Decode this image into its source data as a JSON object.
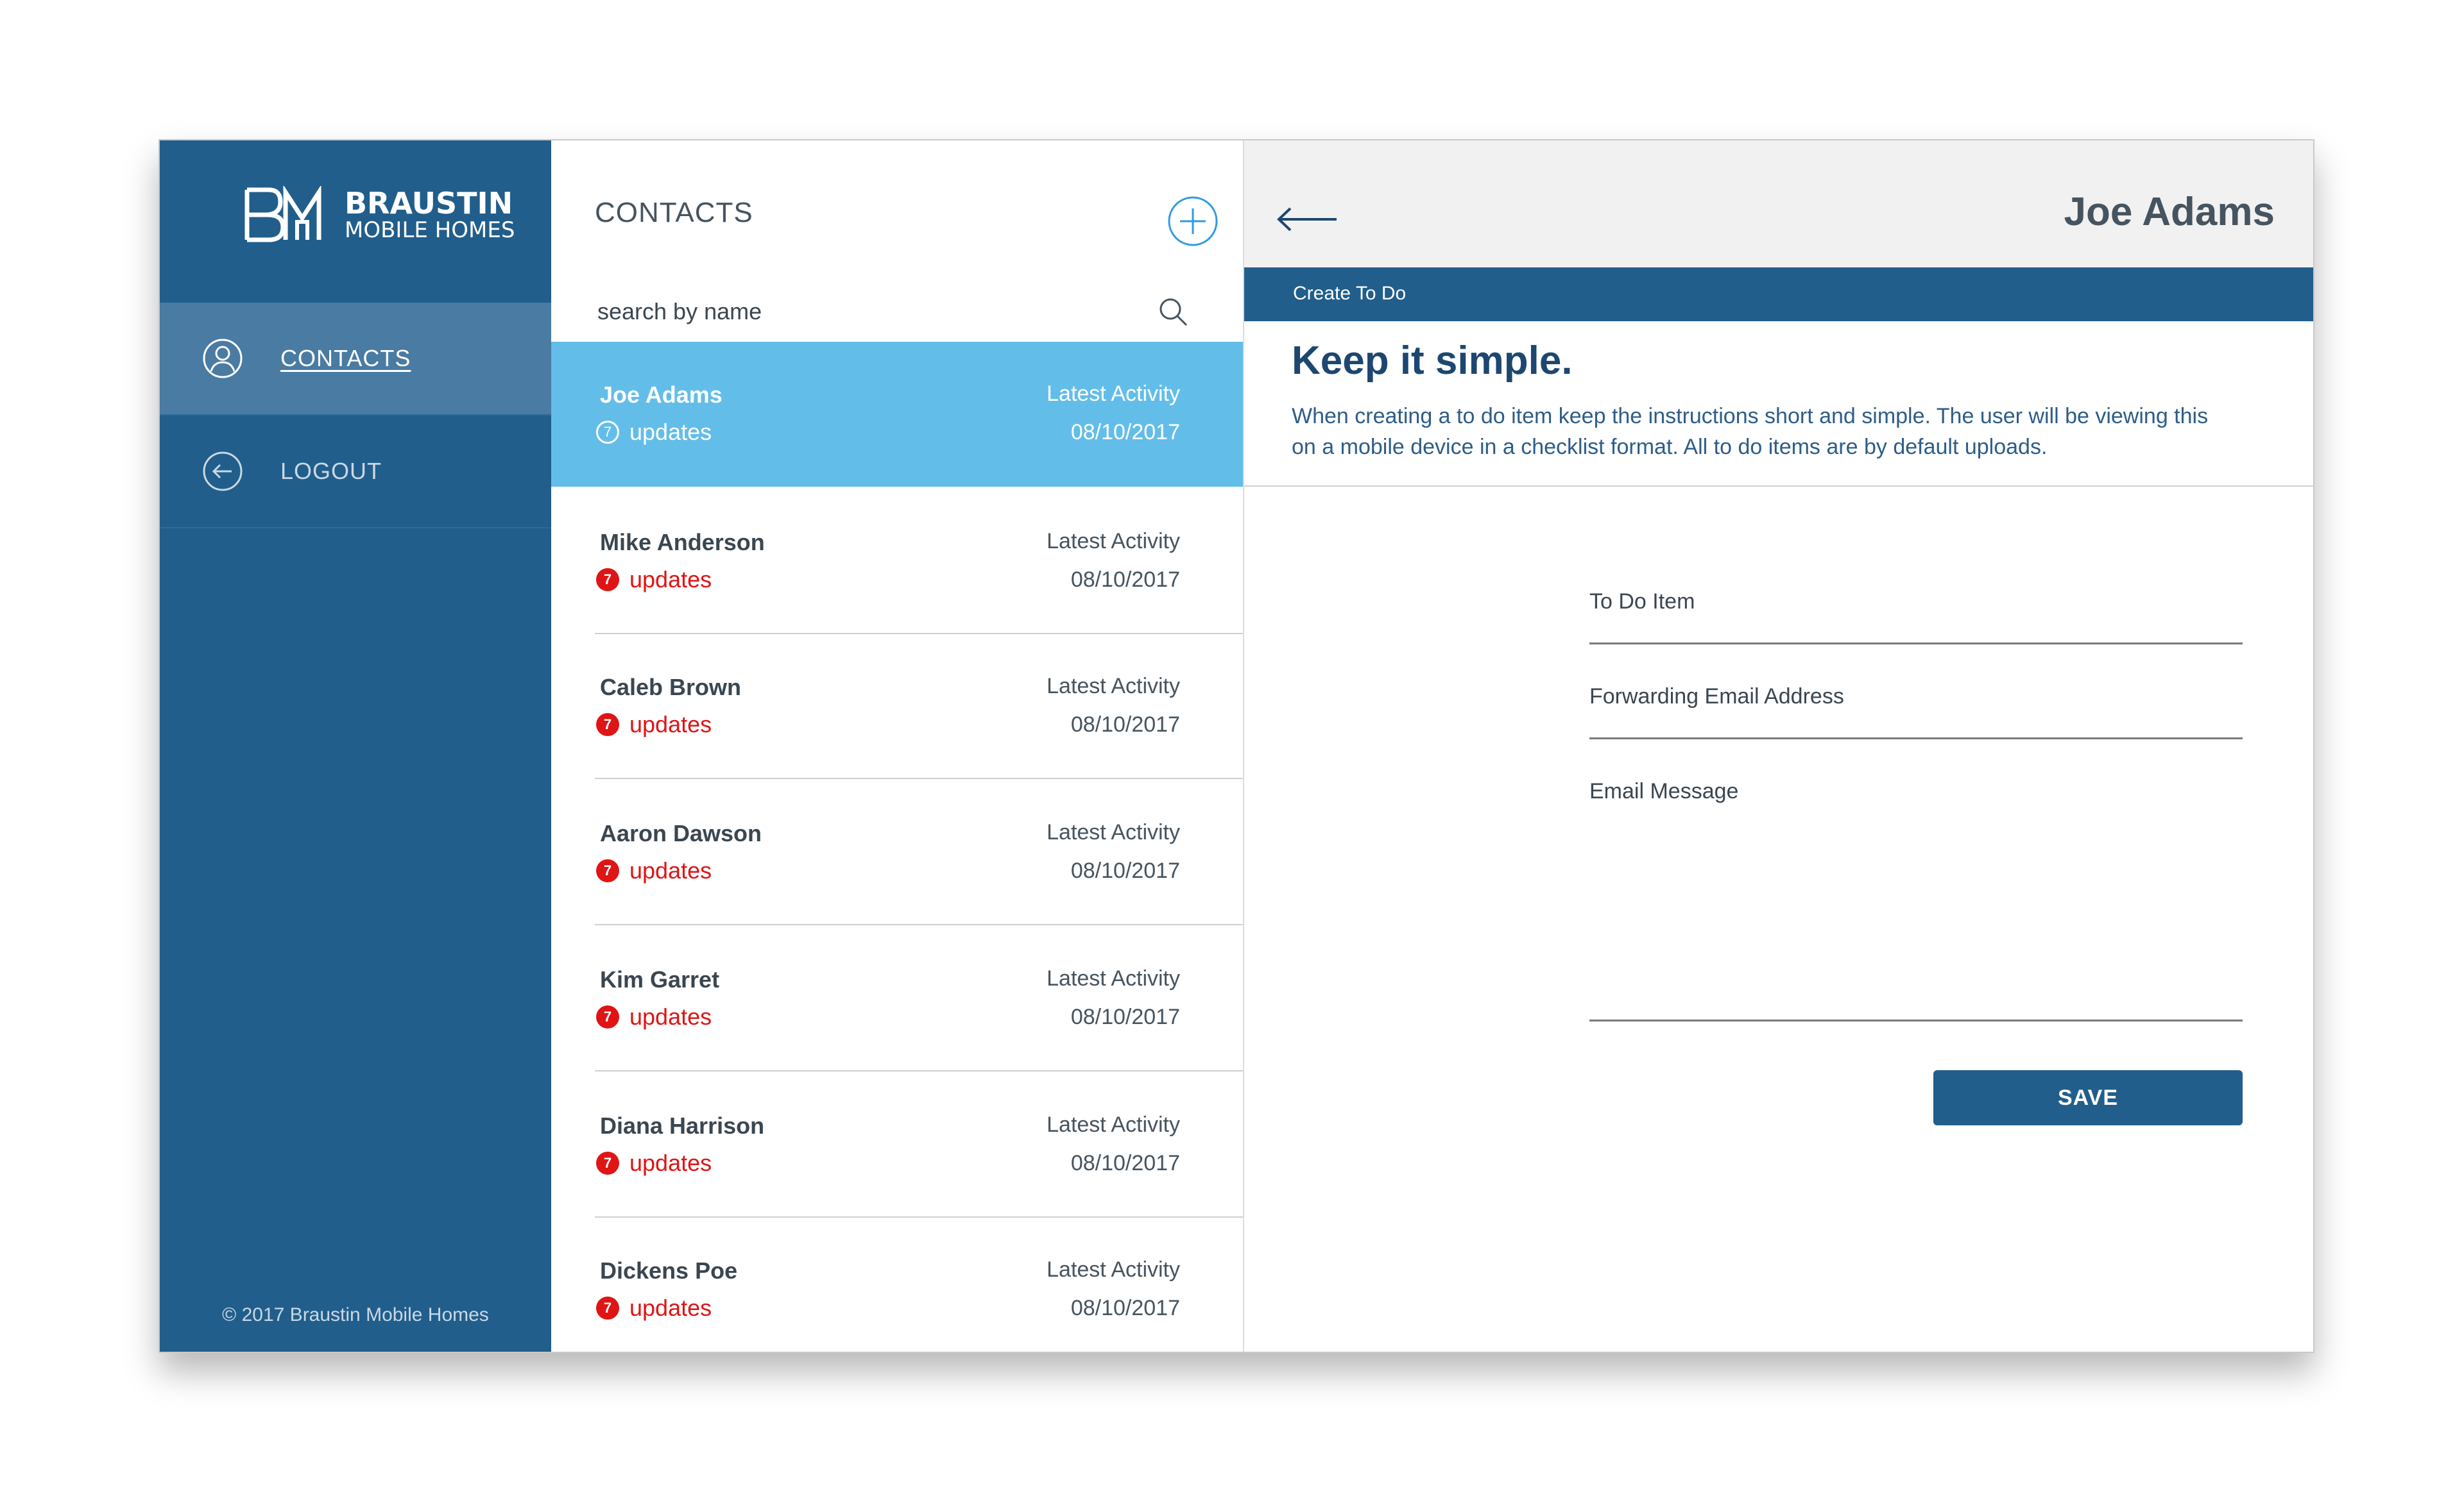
{
  "brand": {
    "monogram": "BM",
    "line1": "BRAUSTIN",
    "line2": "MOBILE HOMES"
  },
  "sidebar": {
    "items": [
      {
        "label": "CONTACTS",
        "icon": "user-circle-icon",
        "active": true
      },
      {
        "label": "LOGOUT",
        "icon": "arrow-left-circle-icon",
        "active": false
      }
    ],
    "copyright": "© 2017 Braustin Mobile Homes"
  },
  "contacts": {
    "title": "CONTACTS",
    "search_placeholder": "search by name",
    "list": [
      {
        "name": "Joe Adams",
        "updates_count": "7",
        "updates_label": "updates",
        "activity_label": "Latest Activity",
        "activity_date": "08/10/2017"
      },
      {
        "name": "Mike Anderson",
        "updates_count": "7",
        "updates_label": "updates",
        "activity_label": "Latest Activity",
        "activity_date": "08/10/2017"
      },
      {
        "name": "Caleb Brown",
        "updates_count": "7",
        "updates_label": "updates",
        "activity_label": "Latest Activity",
        "activity_date": "08/10/2017"
      },
      {
        "name": "Aaron Dawson",
        "updates_count": "7",
        "updates_label": "updates",
        "activity_label": "Latest Activity",
        "activity_date": "08/10/2017"
      },
      {
        "name": "Kim Garret",
        "updates_count": "7",
        "updates_label": "updates",
        "activity_label": "Latest Activity",
        "activity_date": "08/10/2017"
      },
      {
        "name": "Diana Harrison",
        "updates_count": "7",
        "updates_label": "updates",
        "activity_label": "Latest Activity",
        "activity_date": "08/10/2017"
      },
      {
        "name": "Dickens Poe",
        "updates_count": "7",
        "updates_label": "updates",
        "activity_label": "Latest Activity",
        "activity_date": "08/10/2017"
      }
    ]
  },
  "detail": {
    "title": "Joe Adams",
    "section_bar": "Create To Do",
    "headline": "Keep it simple.",
    "description": "When creating a to do item keep the instructions short and simple. The user will be viewing this on a mobile device in a checklist format. All to do items are by default uploads.",
    "fields": {
      "todo_label": "To Do Item",
      "email_label": "Forwarding Email Address",
      "message_label": "Email Message"
    },
    "save_label": "SAVE"
  },
  "colors": {
    "sidebar": "#215e8b",
    "sidebar_active": "#4a7ba3",
    "selected_row": "#63bde9",
    "badge": "#e01414",
    "accent": "#2e9be0"
  }
}
